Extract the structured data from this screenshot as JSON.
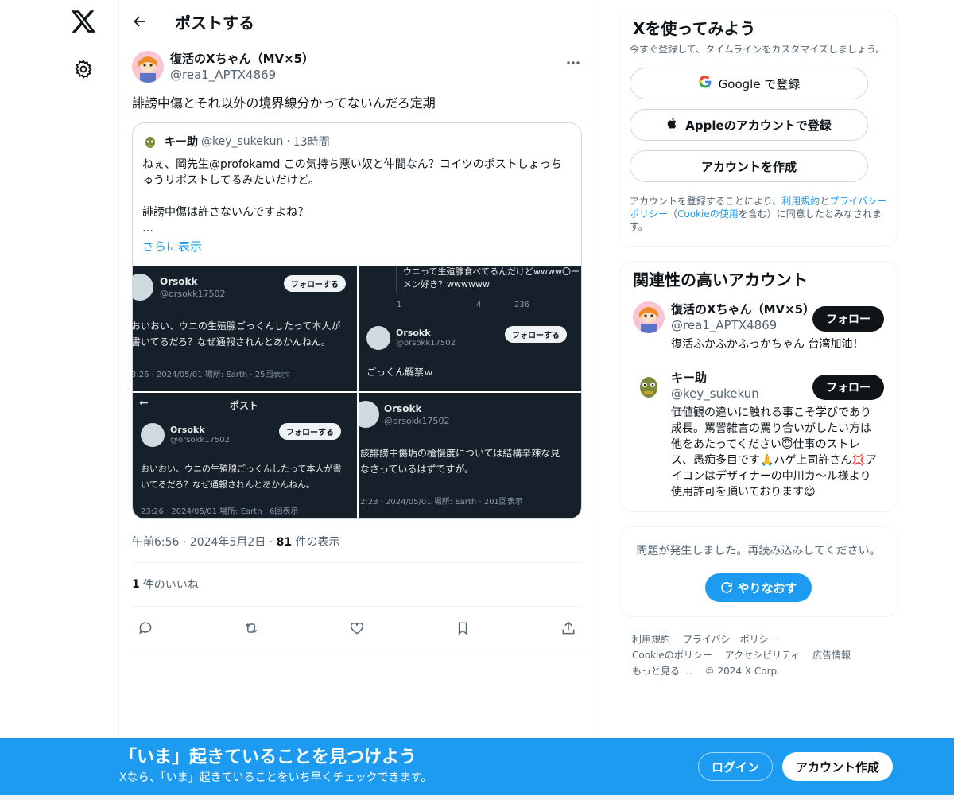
{
  "header": {
    "title": "ポストする"
  },
  "post": {
    "display_name": "復活のXちゃん（MV×5）",
    "handle": "@rea1_APTX4869",
    "text": "誹謗中傷とそれ以外の境界線分かってないんだろ定期",
    "quote": {
      "name": "キー助",
      "handle": "@key_sukekun",
      "dot": "·",
      "time": "13時間",
      "text": "ねぇ、岡先生@profokamd この気持ち悪い奴と仲間なん？コイツのポストしょっちゅうリポストしてるみたいだけど。\n\n誹謗中傷は許さないんですよね？\n…",
      "show_more": "さらに表示",
      "images": [
        {
          "name": "Orsokk",
          "handle": "@orsokk17502",
          "follow": "フォローする",
          "text": "おいおい、ウニの生殖腺ごっくんしたって本人が\n書いてるだろ？なぜ通報されんとあかんねん。",
          "meta": "3:26 · 2024/05/01 場所: Earth · 25回表示"
        },
        {
          "top_text": "ウニって生殖腺食べてるんだけどwwww〇ー\nメン好き？wwwwww",
          "stats": [
            "1",
            "",
            "4",
            "236"
          ],
          "name": "Orsokk",
          "handle": "@orsokk17502",
          "follow": "フォローする",
          "text": "ごっくん解禁ｗ"
        },
        {
          "bar_title": "ポスト",
          "name": "Orsokk",
          "handle": "@orsokk17502",
          "follow": "フォローする",
          "text": "おいおい、ウニの生殖腺ごっくんしたって本人が書\nいてるだろ？なぜ通報されんとあかんねん。",
          "meta": "23:26 · 2024/05/01 場所: Earth · 6回表示"
        },
        {
          "name": "Orsokk",
          "handle": "@orsokk17502",
          "text": "該誹謗中傷垢の槍慢度については結構辛辣な見\nなさっているはずですが。",
          "meta": "2:23 · 2024/05/01 場所: Earth · 201回表示"
        }
      ]
    },
    "meta_time": "午前6:56 · 2024年5月2日 · ",
    "views_count": "81",
    "views_label": " 件の表示",
    "likes_count": "1",
    "likes_label": "件のいいね"
  },
  "signup": {
    "title": "Xを使ってみよう",
    "subtitle": "今すぐ登録して、タイムラインをカスタマイズしましょう。",
    "google": "Google で登録",
    "apple": "Appleのアカウントで登録",
    "create": "アカウントを作成",
    "terms_prefix": "アカウントを登録することにより、",
    "terms_link": "利用規約",
    "terms_and": "と",
    "privacy_link": "プライバシーポリシー",
    "terms_mid": "（",
    "cookie_link": "Cookieの使用",
    "terms_suffix": "を含む）に同意したとみなされます。"
  },
  "related": {
    "title": "関連性の高いアカウント",
    "accounts": [
      {
        "name": "復活のXちゃん（MV×5）",
        "handle": "@rea1_APTX4869",
        "bio": "復活ふかふかふっかちゃん 台湾加油！",
        "follow": "フォロー"
      },
      {
        "name": "キー助",
        "handle": "@key_sukekun",
        "bio": "価値観の違いに触れる事こそ学びであり成長。罵詈雑言の罵り合いがしたい方は他をあたってください😇仕事のストレス、愚痴多目です🙏ハゲ上司許さん💢アイコンはデザイナーの中川カ〜ル様より使用許可を頂いております😊",
        "follow": "フォロー"
      }
    ]
  },
  "error": {
    "text": "問題が発生しました。再読み込みしてください。",
    "retry": "やりなおす"
  },
  "footer": {
    "links": [
      "利用規約",
      "プライバシーポリシー",
      "Cookieのポリシー",
      "アクセシビリティ",
      "広告情報",
      "もっと見る …"
    ],
    "copyright": "© 2024 X Corp."
  },
  "banner": {
    "title": "「いま」起きていることを見つけよう",
    "subtitle": "Xなら、「いま」起きていることをいち早くチェックできます。",
    "login": "ログイン",
    "signup": "アカウント作成"
  },
  "colors": {
    "accent": "#1d9bf0",
    "text": "#0f1419",
    "muted": "#536471",
    "dark_card": "#15202b"
  }
}
